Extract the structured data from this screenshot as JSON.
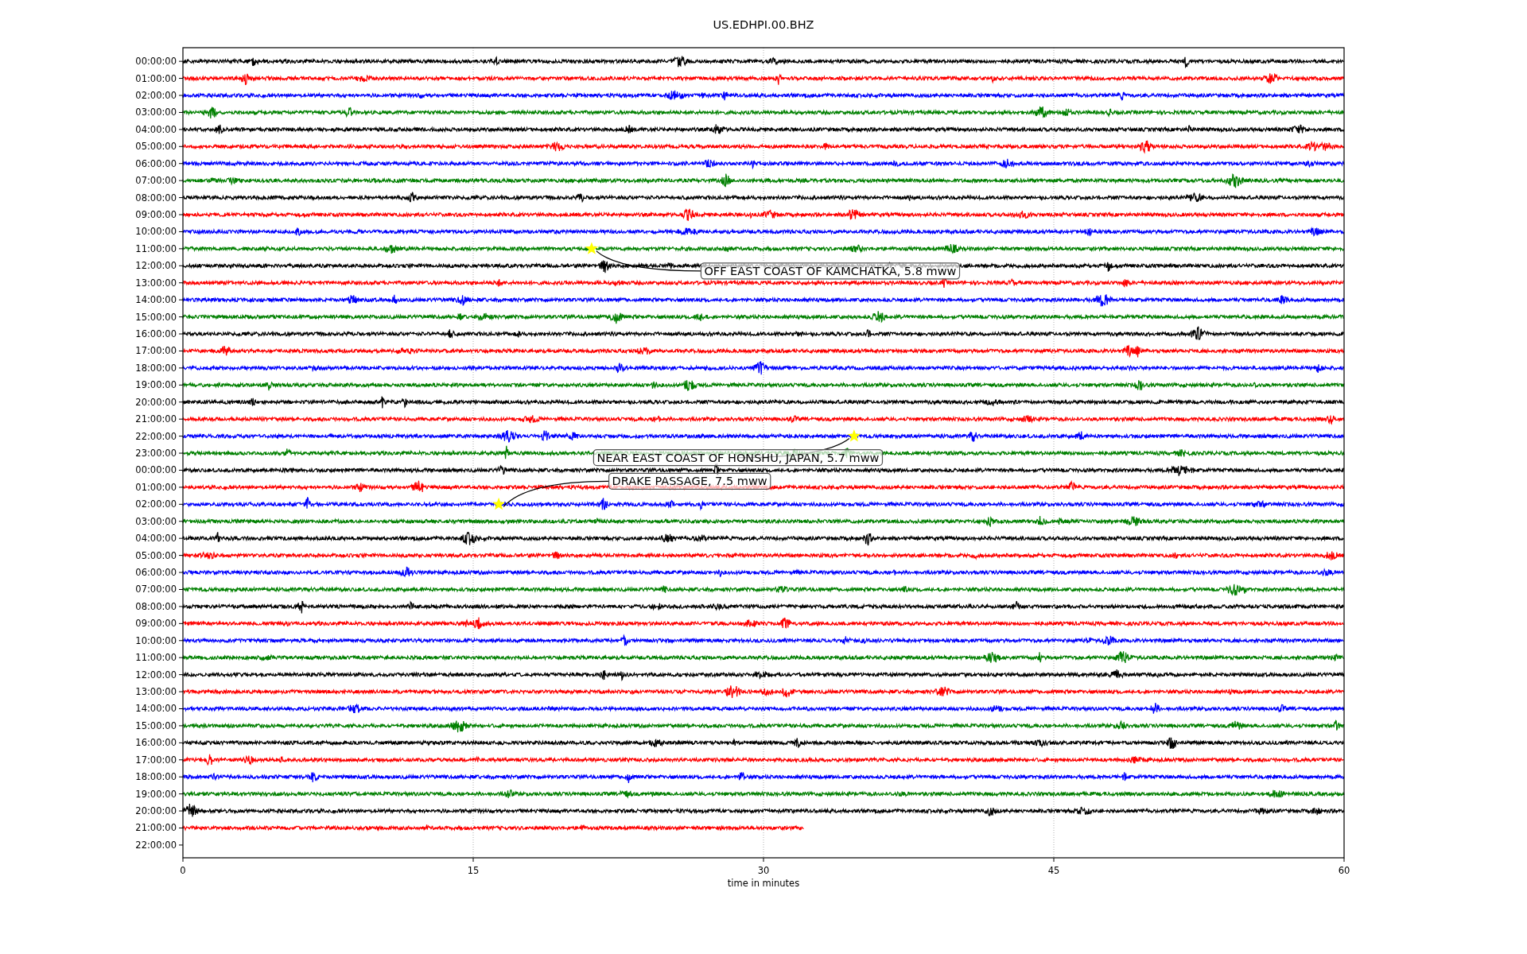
{
  "figure": {
    "title": "US.EDHPI.00.BHZ",
    "x_axis": {
      "label": "time in minutes",
      "ticks": [
        "0",
        "15",
        "30",
        "45",
        "60"
      ]
    },
    "annotations": [
      {
        "text": "OFF EAST COAST OF KAMCHATKA, 5.8 mww"
      },
      {
        "text": "NEAR EAST COAST OF HONSHU, JAPAN, 5.7 mww"
      },
      {
        "text": "DRAKE PASSAGE, 7.5 mww"
      }
    ],
    "rows": [
      {
        "label": "00:00:00",
        "color": "#000000",
        "level": 1
      },
      {
        "label": "01:00:00",
        "color": "#ff0000",
        "level": 1
      },
      {
        "label": "02:00:00",
        "color": "#0000ff",
        "level": 1
      },
      {
        "label": "03:00:00",
        "color": "#008000",
        "level": 1
      },
      {
        "label": "04:00:00",
        "color": "#000000",
        "level": 1
      },
      {
        "label": "05:00:00",
        "color": "#ff0000",
        "level": 1
      },
      {
        "label": "06:00:00",
        "color": "#0000ff",
        "level": 1
      },
      {
        "label": "07:00:00",
        "color": "#008000",
        "level": 1
      },
      {
        "label": "08:00:00",
        "color": "#000000",
        "level": 1
      },
      {
        "label": "09:00:00",
        "color": "#ff0000",
        "level": 1
      },
      {
        "label": "10:00:00",
        "color": "#0000ff",
        "level": 1
      },
      {
        "label": "11:00:00",
        "color": "#008000",
        "level": 1
      },
      {
        "label": "12:00:00",
        "color": "#000000",
        "level": 1
      },
      {
        "label": "13:00:00",
        "color": "#ff0000",
        "level": 1
      },
      {
        "label": "14:00:00",
        "color": "#0000ff",
        "level": 1
      },
      {
        "label": "15:00:00",
        "color": "#008000",
        "level": 1
      },
      {
        "label": "16:00:00",
        "color": "#000000",
        "level": 1
      },
      {
        "label": "17:00:00",
        "color": "#ff0000",
        "level": 1
      },
      {
        "label": "18:00:00",
        "color": "#0000ff",
        "level": 1
      },
      {
        "label": "19:00:00",
        "color": "#008000",
        "level": 1
      },
      {
        "label": "20:00:00",
        "color": "#000000",
        "level": 1
      },
      {
        "label": "21:00:00",
        "color": "#ff0000",
        "level": 1
      },
      {
        "label": "22:00:00",
        "color": "#0000ff",
        "level": 1
      },
      {
        "label": "23:00:00",
        "color": "#008000",
        "level": 1
      },
      {
        "label": "00:00:00",
        "color": "#000000",
        "level": 1
      },
      {
        "label": "01:00:00",
        "color": "#ff0000",
        "level": 1
      },
      {
        "label": "02:00:00",
        "color": "#0000ff",
        "level": 1
      },
      {
        "label": "03:00:00",
        "color": "#008000",
        "level": 1
      },
      {
        "label": "04:00:00",
        "color": "#000000",
        "level": 1
      },
      {
        "label": "05:00:00",
        "color": "#ff0000",
        "level": 1
      },
      {
        "label": "06:00:00",
        "color": "#0000ff",
        "level": 1
      },
      {
        "label": "07:00:00",
        "color": "#008000",
        "level": 1
      },
      {
        "label": "08:00:00",
        "color": "#000000",
        "level": 1
      },
      {
        "label": "09:00:00",
        "color": "#ff0000",
        "level": 1
      },
      {
        "label": "10:00:00",
        "color": "#0000ff",
        "level": 1
      },
      {
        "label": "11:00:00",
        "color": "#008000",
        "level": 1
      },
      {
        "label": "12:00:00",
        "color": "#000000",
        "level": 1
      },
      {
        "label": "13:00:00",
        "color": "#ff0000",
        "level": 1
      },
      {
        "label": "14:00:00",
        "color": "#0000ff",
        "level": 1
      },
      {
        "label": "15:00:00",
        "color": "#008000",
        "level": 1
      },
      {
        "label": "16:00:00",
        "color": "#000000",
        "level": 1
      },
      {
        "label": "17:00:00",
        "color": "#ff0000",
        "level": 1
      },
      {
        "label": "18:00:00",
        "color": "#0000ff",
        "level": 1
      },
      {
        "label": "19:00:00",
        "color": "#008000",
        "level": 1
      },
      {
        "label": "20:00:00",
        "color": "#000000",
        "level": 1
      },
      {
        "label": "21:00:00",
        "color": "#ff0000",
        "level": 0.535
      },
      {
        "label": "22:00:00"
      }
    ]
  }
}
